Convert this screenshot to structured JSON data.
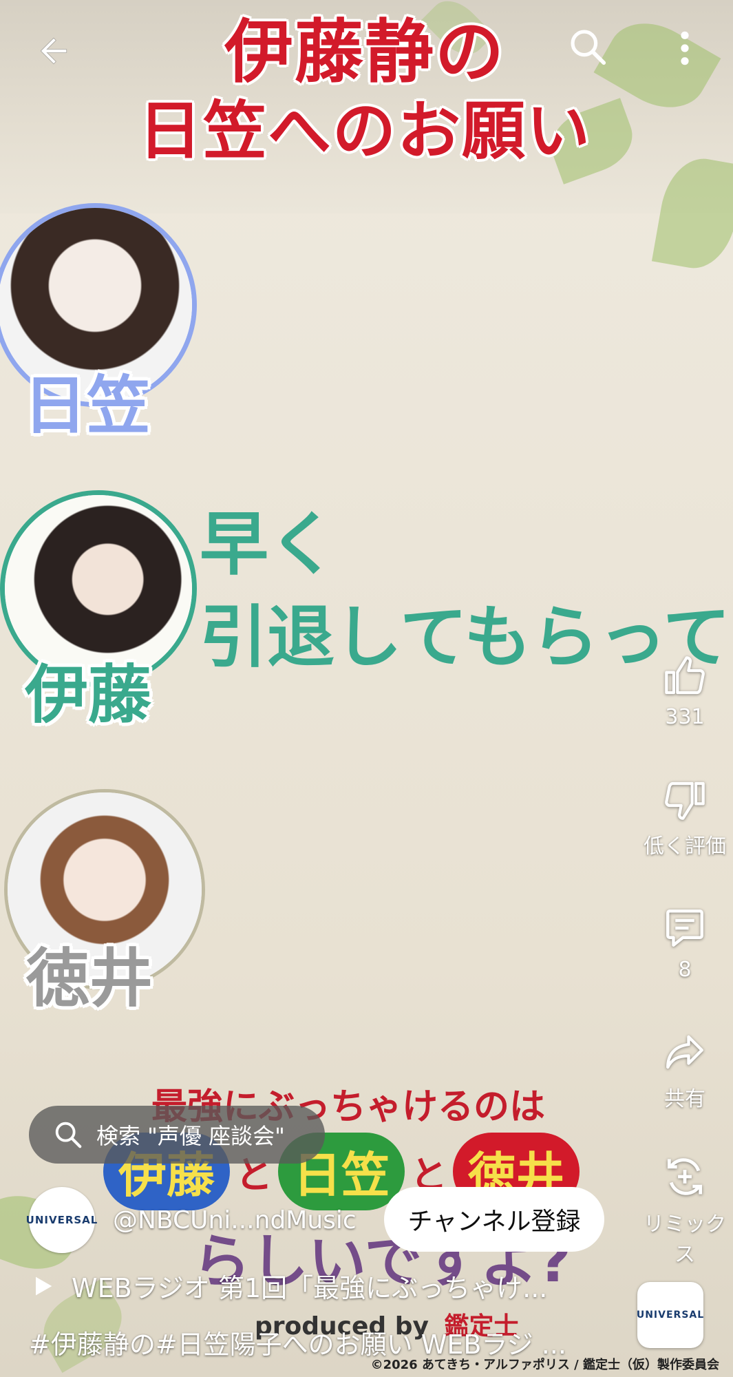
{
  "video": {
    "title_line1": "伊藤静の",
    "title_line2": "日笠へのお願い",
    "people": [
      {
        "name": "日笠",
        "color": "#8fa6ee"
      },
      {
        "name": "伊藤",
        "color": "#3aa98d"
      },
      {
        "name": "徳井",
        "color": "#9a9a9a"
      }
    ],
    "quote_line1": "早く",
    "quote_line2": "引退してもらって",
    "banner_top": "最強にぶっちゃけるのは",
    "banner_names": [
      "伊藤",
      "と",
      "日笠",
      "と",
      "徳井"
    ],
    "banner_bottom": "らしいですよ?",
    "produced_by": "produced by",
    "brand_mark": "鑑定士",
    "copyright": "©2026 あてきち・アルファポリス / 鑑定士（仮）製作委員会"
  },
  "actions": {
    "like_count": "331",
    "dislike_label": "低く評価",
    "comment_count": "8",
    "share_label": "共有",
    "remix_label": "リミックス"
  },
  "search_chip": {
    "label": "検索 \"声優 座談会\""
  },
  "channel": {
    "logo_text": "UNIVERSAL",
    "handle": "@NBCUni...ndMusic",
    "subscribe_label": "チャンネル登録"
  },
  "description": {
    "title": "WEBラジオ 第1回「最強にぶっちゃけ...",
    "hashtags": "#伊藤静の#日笠陽子へのお願い WEBラジ ..."
  },
  "colors": {
    "title_red": "#d21a2a",
    "quote_green": "#3aa98d"
  },
  "icons": [
    "back-arrow-icon",
    "search-icon",
    "more-vert-icon",
    "thumb-up-icon",
    "thumb-down-icon",
    "comment-icon",
    "share-icon",
    "remix-icon",
    "play-icon"
  ]
}
